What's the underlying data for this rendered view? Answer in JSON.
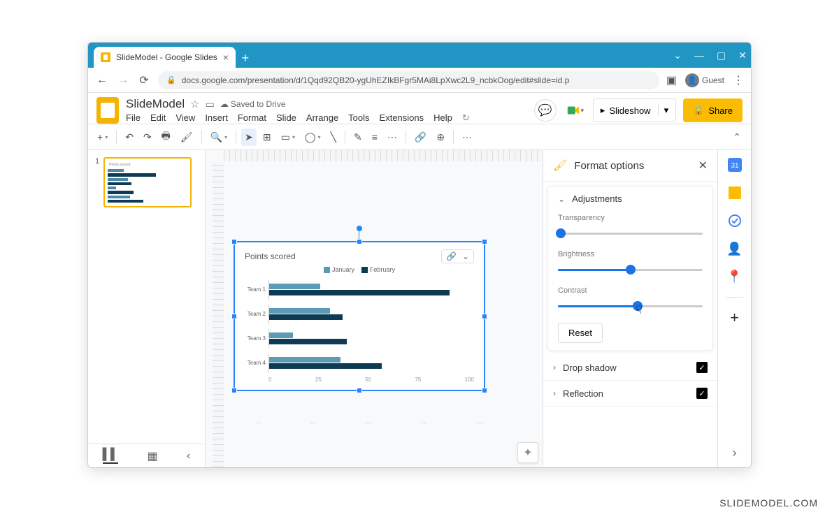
{
  "watermark": "SLIDEMODEL.COM",
  "browser": {
    "tab_title": "SlideModel - Google Slides",
    "url": "docs.google.com/presentation/d/1Qqd92QB20-ygUhEZIkBFgr5MAi8LpXwc2L9_ncbkOog/edit#slide=id.p",
    "guest_label": "Guest"
  },
  "app": {
    "doc_title": "SlideModel",
    "saved_text": "Saved to Drive",
    "menus": [
      "File",
      "Edit",
      "View",
      "Insert",
      "Format",
      "Slide",
      "Arrange",
      "Tools",
      "Extensions",
      "Help"
    ],
    "slideshow_label": "Slideshow",
    "share_label": "Share"
  },
  "thumb": {
    "number": "1"
  },
  "format_panel": {
    "title": "Format options",
    "sections": {
      "adjustments": "Adjustments",
      "drop_shadow": "Drop shadow",
      "reflection": "Reflection"
    },
    "sliders": {
      "transparency": "Transparency",
      "brightness": "Brightness",
      "contrast": "Contrast"
    },
    "reset_label": "Reset"
  },
  "chart_data": {
    "type": "bar",
    "title": "Points scored",
    "orientation": "horizontal",
    "categories": [
      "Team 1",
      "Team 2",
      "Team 3",
      "Team 4"
    ],
    "series": [
      {
        "name": "January",
        "color": "#5b9bb5",
        "values": [
          25,
          30,
          12,
          35
        ]
      },
      {
        "name": "February",
        "color": "#0e3a53",
        "values": [
          88,
          36,
          38,
          55
        ]
      }
    ],
    "xaxis_ticks": [
      "0",
      "25",
      "50",
      "75",
      "100"
    ],
    "reflection_ticks": [
      "0",
      "32",
      "26",
      "12",
      "103"
    ],
    "xlim": [
      0,
      100
    ]
  }
}
